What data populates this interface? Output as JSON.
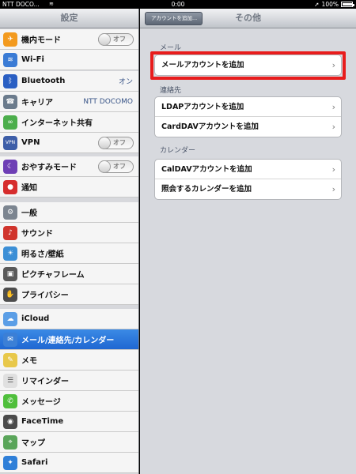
{
  "status_bar": {
    "carrier": "NTT DOCO...",
    "wifi_icon": "wifi-icon",
    "time": "0:00",
    "battery": "100%",
    "battery_level": 1.0
  },
  "sidebar": {
    "title": "設定",
    "items": [
      {
        "label": "機内モード",
        "icon": "airplane-icon",
        "color": "#f39a1e",
        "glyph": "✈",
        "toggle": "オフ"
      },
      {
        "label": "Wi-Fi",
        "icon": "wifi-icon",
        "color": "#3a7bd5",
        "glyph": "≋"
      },
      {
        "label": "Bluetooth",
        "icon": "bluetooth-icon",
        "color": "#2a5fc3",
        "glyph": "ᛒ",
        "value": "オン"
      },
      {
        "label": "キャリア",
        "icon": "phone-icon",
        "color": "#6b7b8c",
        "glyph": "☎",
        "value": "NTT DOCOMO"
      },
      {
        "label": "インターネット共有",
        "icon": "link-icon",
        "color": "#4cae4c",
        "glyph": "∞"
      },
      {
        "label": "VPN",
        "icon": "vpn-icon",
        "color": "#3d5ea8",
        "glyph": "VPN",
        "toggle": "オフ"
      },
      {
        "label": "おやすみモード",
        "icon": "moon-icon",
        "color": "#6e3fb5",
        "glyph": "☾",
        "toggle": "オフ"
      },
      {
        "label": "通知",
        "icon": "notification-icon",
        "color": "#d62d2d",
        "glyph": "●"
      },
      {
        "label": "一般",
        "icon": "gear-icon",
        "color": "#7c8590",
        "glyph": "⚙"
      },
      {
        "label": "サウンド",
        "icon": "speaker-icon",
        "color": "#d0342c",
        "glyph": "♪"
      },
      {
        "label": "明るさ/壁紙",
        "icon": "brightness-icon",
        "color": "#3c8fd6",
        "glyph": "☀"
      },
      {
        "label": "ピクチャフレーム",
        "icon": "picture-frame-icon",
        "color": "#5a5a5a",
        "glyph": "▣"
      },
      {
        "label": "プライバシー",
        "icon": "hand-icon",
        "color": "#4d4d4d",
        "glyph": "✋"
      },
      {
        "label": "iCloud",
        "icon": "cloud-icon",
        "color": "#5b9ee6",
        "glyph": "☁"
      },
      {
        "label": "メール/連絡先/カレンダー",
        "icon": "mail-icon",
        "color": "#3b7fd6",
        "glyph": "✉",
        "selected": true
      },
      {
        "label": "メモ",
        "icon": "notes-icon",
        "color": "#e8c84a",
        "glyph": "✎"
      },
      {
        "label": "リマインダー",
        "icon": "reminders-icon",
        "color": "#e0e0e0",
        "glyph": "☰"
      },
      {
        "label": "メッセージ",
        "icon": "messages-icon",
        "color": "#4fbf3b",
        "glyph": "✆"
      },
      {
        "label": "FaceTime",
        "icon": "facetime-icon",
        "color": "#4a4a4a",
        "glyph": "◉"
      },
      {
        "label": "マップ",
        "icon": "map-icon",
        "color": "#5aa55a",
        "glyph": "⌖"
      },
      {
        "label": "Safari",
        "icon": "safari-icon",
        "color": "#2f7fd8",
        "glyph": "✦"
      }
    ]
  },
  "main": {
    "back_label": "アカウントを追加...",
    "title": "その他",
    "sections": [
      {
        "label": "メール",
        "rows": [
          "メールアカウントを追加"
        ]
      },
      {
        "label": "連絡先",
        "rows": [
          "LDAPアカウントを追加",
          "CardDAVアカウントを追加"
        ]
      },
      {
        "label": "カレンダー",
        "rows": [
          "CalDAVアカウントを追加",
          "照会するカレンダーを追加"
        ]
      }
    ]
  }
}
